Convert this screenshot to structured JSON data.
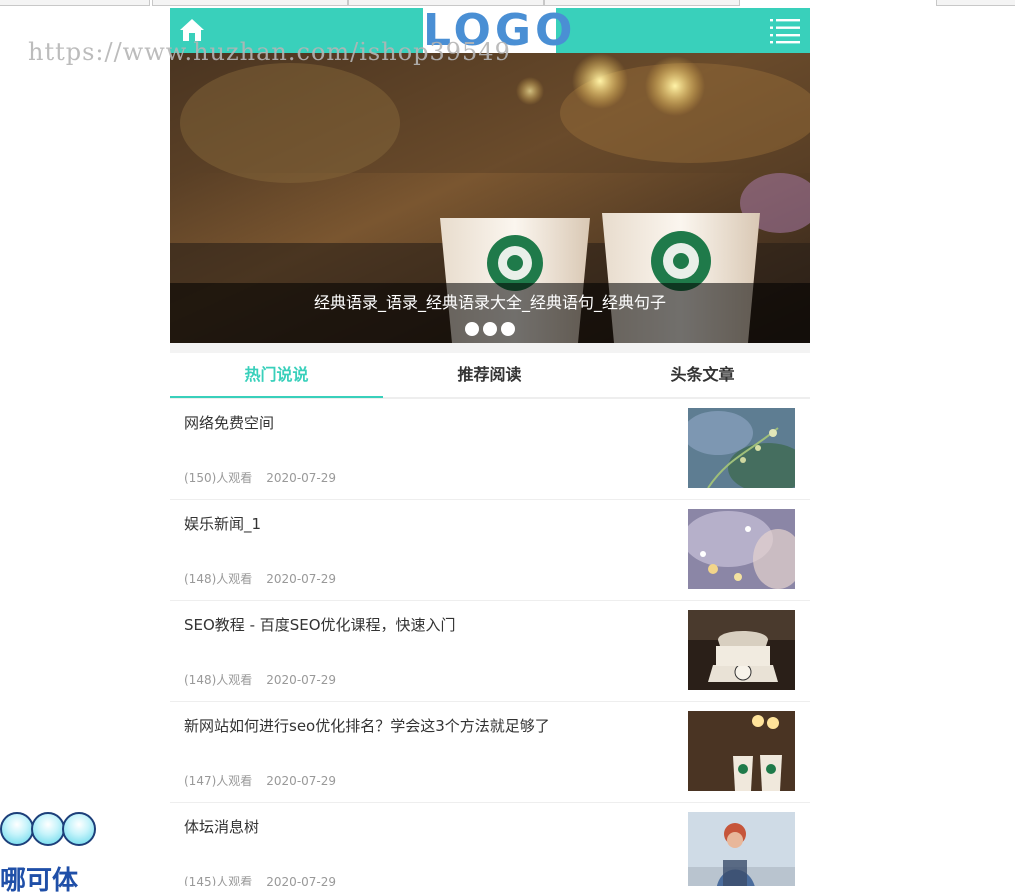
{
  "watermark": "https://www.huzhan.com/ishop39549",
  "header": {
    "logo_text": "LOGO",
    "home_icon": "home-icon",
    "menu_icon": "menu-icon",
    "accent_color": "#39d0bb"
  },
  "banner": {
    "caption": "经典语录_语录_经典语录大全_经典语句_经典句子",
    "slide_count": 3
  },
  "tabs": [
    {
      "label": "热门说说",
      "active": true
    },
    {
      "label": "推荐阅读",
      "active": false
    },
    {
      "label": "头条文章",
      "active": false
    }
  ],
  "articles": [
    {
      "title": "网络免费空间",
      "views": "(150)人观看",
      "date": "2020-07-29"
    },
    {
      "title": "娱乐新闻_1",
      "views": "(148)人观看",
      "date": "2020-07-29"
    },
    {
      "title": "SEO教程 - 百度SEO优化课程，快速入门",
      "views": "(148)人观看",
      "date": "2020-07-29"
    },
    {
      "title": "新网站如何进行seo优化排名？学会这3个方法就足够了",
      "views": "(147)人观看",
      "date": "2020-07-29"
    },
    {
      "title": "体坛消息树",
      "views": "(145)人观看",
      "date": "2020-07-29"
    }
  ],
  "side_text": "哪可体"
}
